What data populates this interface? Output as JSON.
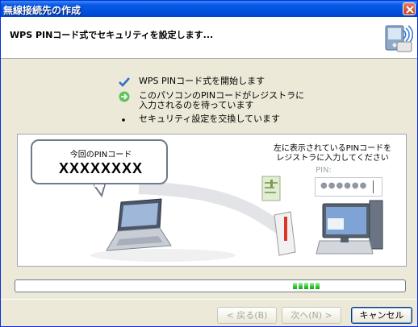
{
  "window": {
    "title": "無線接続先の作成"
  },
  "header": {
    "heading": "WPS PINコード式でセキュリティを設定します..."
  },
  "steps": [
    {
      "status": "done",
      "icon": "check-icon",
      "text": "WPS PINコード式を開始します"
    },
    {
      "status": "current",
      "icon": "arrow-right-icon",
      "text_line1": "このパソコンのPINコードがレジストラに",
      "text_line2": "入力されるのを待っています"
    },
    {
      "status": "pending",
      "icon": "bullet-icon",
      "text": "セキュリティ設定を交換しています"
    }
  ],
  "illustration": {
    "bubble_label": "今回のPINコード",
    "pin_code": "XXXXXXXX",
    "instruction_line1": "左に表示されているPINコードを",
    "instruction_line2": "レジストラに入力してください",
    "pin_field_label": "PIN:",
    "pin_field_value": "●●●●●●"
  },
  "progress": {
    "state": "marquee",
    "chunk_count": 5,
    "colors": {
      "chunk": "#32c632"
    }
  },
  "buttons": {
    "back": "< 戻る(B)",
    "next": "次へ(N) >",
    "cancel": "キャンセル"
  },
  "colors": {
    "titlebar": "#0a5ae6",
    "dialog_bg": "#ece9d8"
  }
}
